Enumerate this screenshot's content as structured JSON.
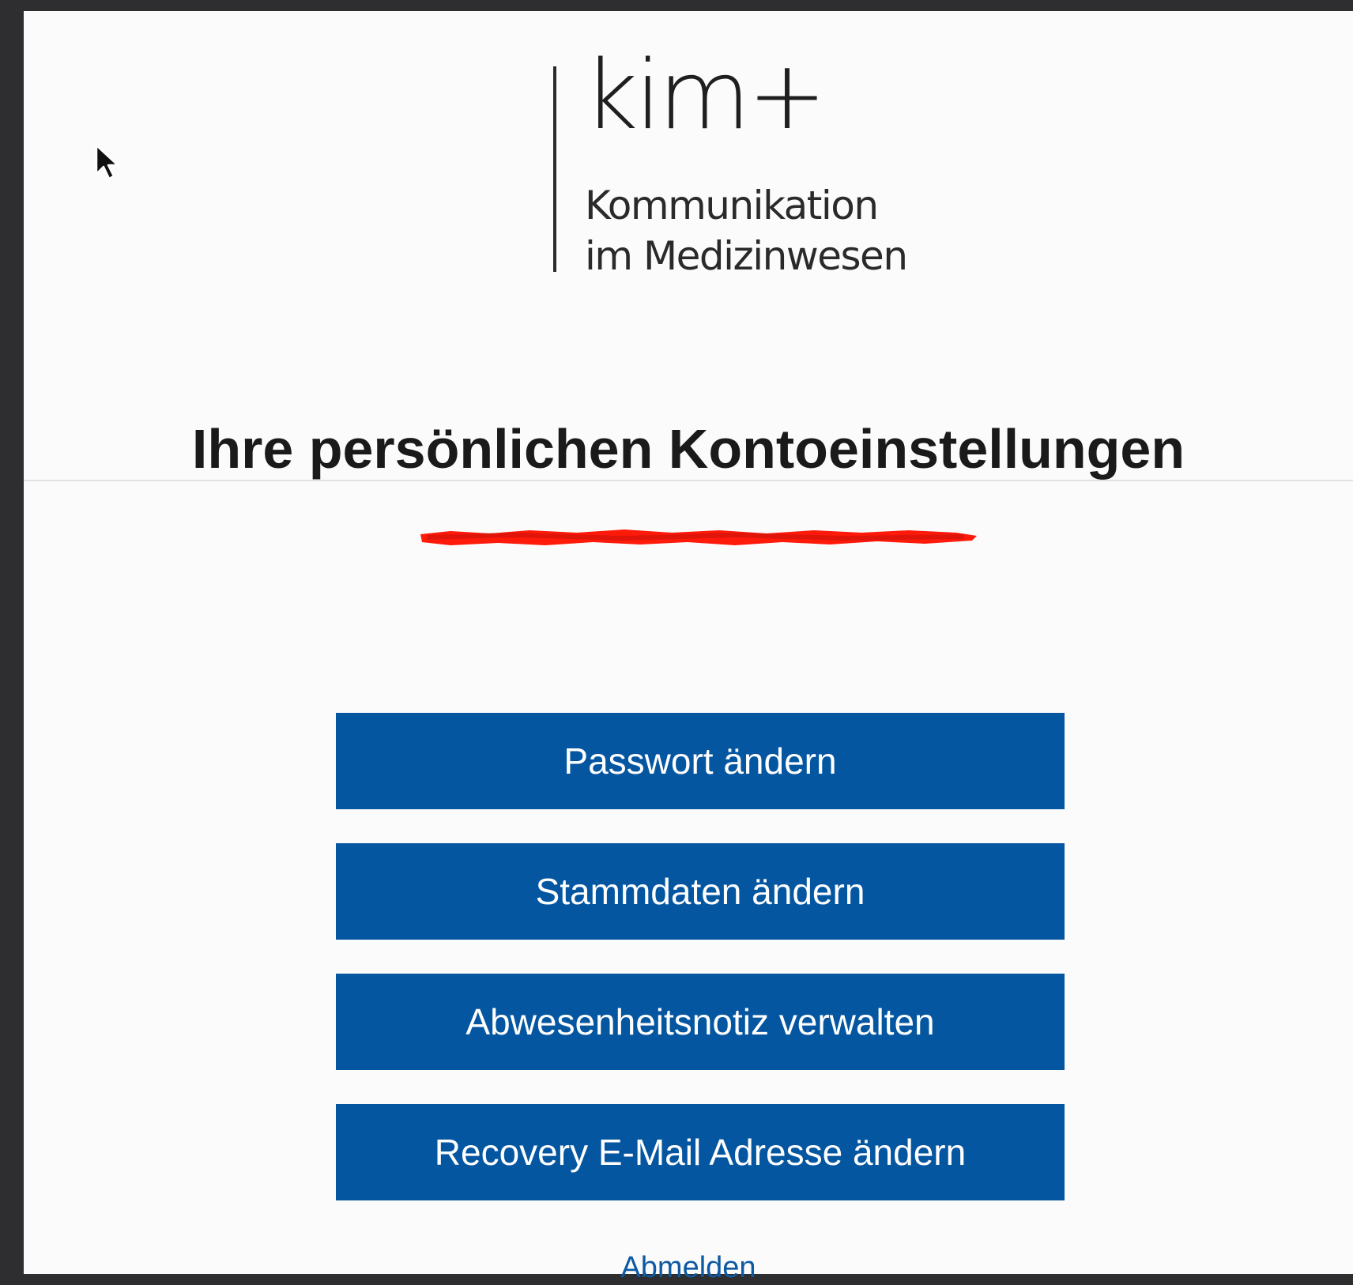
{
  "logo": {
    "wordmark": "kim+",
    "line1": "Kommunikation",
    "line2": "im Medizinwesen"
  },
  "page": {
    "title": "Ihre persönlichen Kontoeinstellungen"
  },
  "actions": {
    "change_password": "Passwort ändern",
    "change_master_data": "Stammdaten ändern",
    "manage_absence_note": "Abwesenheitsnotiz verwalten",
    "change_recovery_email": "Recovery E-Mail Adresse ändern"
  },
  "logout": {
    "label": "Abmelden"
  },
  "colors": {
    "button_bg": "#0556a1",
    "link": "#0d5aa3",
    "redaction": "#ff1a0a",
    "page_bg": "#fbfbfc",
    "frame": "#2e2e30"
  }
}
